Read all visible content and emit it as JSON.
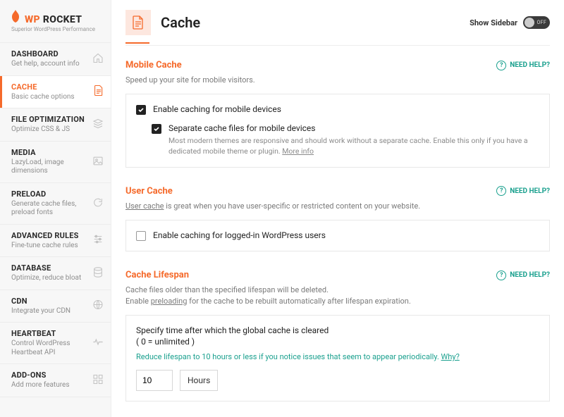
{
  "brand": {
    "wp": "WP",
    "rocket": "ROCKET",
    "tagline": "Superior WordPress Performance"
  },
  "sidebar": {
    "items": [
      {
        "title": "DASHBOARD",
        "desc": "Get help, account info",
        "icon": "home-icon"
      },
      {
        "title": "CACHE",
        "desc": "Basic cache options",
        "icon": "page-icon"
      },
      {
        "title": "FILE OPTIMIZATION",
        "desc": "Optimize CSS & JS",
        "icon": "stack-icon"
      },
      {
        "title": "MEDIA",
        "desc": "LazyLoad, image dimensions",
        "icon": "image-icon"
      },
      {
        "title": "PRELOAD",
        "desc": "Generate cache files, preload fonts",
        "icon": "refresh-icon"
      },
      {
        "title": "ADVANCED RULES",
        "desc": "Fine-tune cache rules",
        "icon": "sliders-icon"
      },
      {
        "title": "DATABASE",
        "desc": "Optimize, reduce bloat",
        "icon": "database-icon"
      },
      {
        "title": "CDN",
        "desc": "Integrate your CDN",
        "icon": "globe-icon"
      },
      {
        "title": "HEARTBEAT",
        "desc": "Control WordPress Heartbeat API",
        "icon": "heartbeat-icon"
      },
      {
        "title": "ADD-ONS",
        "desc": "Add more features",
        "icon": "puzzle-icon"
      }
    ],
    "active_index": 1
  },
  "header": {
    "title": "Cache",
    "show_sidebar_label": "Show Sidebar",
    "toggle_state": "OFF"
  },
  "need_help_label": "NEED HELP?",
  "sections": {
    "mobile": {
      "title": "Mobile Cache",
      "intro": "Speed up your site for mobile visitors.",
      "opt1": {
        "label": "Enable caching for mobile devices",
        "checked": true
      },
      "opt2": {
        "label": "Separate cache files for mobile devices",
        "checked": true,
        "sub": "Most modern themes are responsive and should work without a separate cache. Enable this only if you have a dedicated mobile theme or plugin.",
        "more": "More info"
      }
    },
    "user": {
      "title": "User Cache",
      "intro_pre": "User cache",
      "intro_post": " is great when you have user-specific or restricted content on your website.",
      "opt": {
        "label": "Enable caching for logged-in WordPress users",
        "checked": false
      }
    },
    "lifespan": {
      "title": "Cache Lifespan",
      "intro_line1": "Cache files older than the specified lifespan will be deleted.",
      "intro_line2_pre": "Enable ",
      "intro_line2_link": "preloading",
      "intro_line2_post": " for the cache to be rebuilt automatically after lifespan expiration.",
      "box_title": "Specify time after which the global cache is cleared",
      "box_sub": "( 0 = unlimited )",
      "tip_pre": "Reduce lifespan to 10 hours or less if you notice issues that seem to appear periodically. ",
      "tip_link": "Why?",
      "value": "10",
      "unit": "Hours"
    }
  }
}
